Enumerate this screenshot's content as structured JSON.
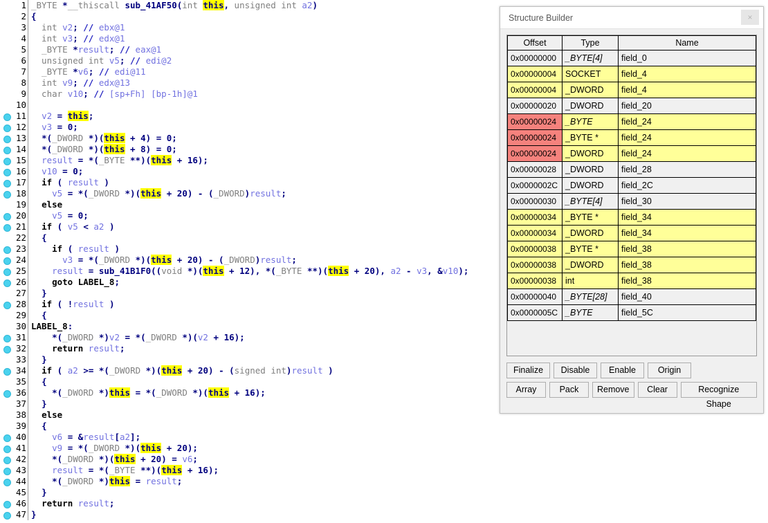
{
  "code_pane": {
    "name": "hexrays-decompiler-pseudocode",
    "lines": [
      {
        "n": "1",
        "bp": false,
        "t": "<span class='k'>_BYTE </span><span class='op'>*</span><span class='k'>__thiscall </span><span class='fn'>sub_41AF50</span><span class='op'>(</span><span class='k'>int </span><span class='hl'>this</span><span class='op'>,</span><span class='k'> unsigned int </span><span class='var'>a2</span><span class='op'>)</span>"
      },
      {
        "n": "2",
        "bp": false,
        "t": "<span class='op'>{</span>"
      },
      {
        "n": "3",
        "bp": false,
        "t": "<span class='k'>  int </span><span class='var'>v2</span><span class='op'>;</span> <span class='cm'>// </span><span class='cmt'>ebx@1</span>"
      },
      {
        "n": "4",
        "bp": false,
        "t": "<span class='k'>  int </span><span class='var'>v3</span><span class='op'>;</span> <span class='cm'>// </span><span class='cmt'>edx@1</span>"
      },
      {
        "n": "5",
        "bp": false,
        "t": "<span class='k'>  _BYTE </span><span class='op'>*</span><span class='var'>result</span><span class='op'>;</span> <span class='cm'>// </span><span class='cmt'>eax@1</span>"
      },
      {
        "n": "6",
        "bp": false,
        "t": "<span class='k'>  unsigned int </span><span class='var'>v5</span><span class='op'>;</span> <span class='cm'>// </span><span class='cmt'>edi@2</span>"
      },
      {
        "n": "7",
        "bp": false,
        "t": "<span class='k'>  _BYTE </span><span class='op'>*</span><span class='var'>v6</span><span class='op'>;</span> <span class='cm'>// </span><span class='cmt'>edi@11</span>"
      },
      {
        "n": "8",
        "bp": false,
        "t": "<span class='k'>  int </span><span class='var'>v9</span><span class='op'>;</span> <span class='cm'>// </span><span class='cmt'>edx@13</span>"
      },
      {
        "n": "9",
        "bp": false,
        "t": "<span class='k'>  char </span><span class='var'>v10</span><span class='op'>;</span> <span class='cm'>// </span><span class='cmt'>[sp+Fh] [bp-1h]@1</span>"
      },
      {
        "n": "10",
        "bp": false,
        "t": ""
      },
      {
        "n": "11",
        "bp": true,
        "t": "  <span class='var'>v2</span> <span class='op'>=</span> <span class='hl'>this</span><span class='op'>;</span>"
      },
      {
        "n": "12",
        "bp": true,
        "t": "  <span class='var'>v3</span> <span class='op'>=</span> <span class='num'>0</span><span class='op'>;</span>"
      },
      {
        "n": "13",
        "bp": true,
        "t": "  <span class='op'>*(</span><span class='k'>_DWORD </span><span class='op'>*)(</span><span class='hl'>this</span> <span class='op'>+</span> <span class='num'>4</span><span class='op'>)</span> <span class='op'>=</span> <span class='num'>0</span><span class='op'>;</span>"
      },
      {
        "n": "14",
        "bp": true,
        "t": "  <span class='op'>*(</span><span class='k'>_DWORD </span><span class='op'>*)(</span><span class='hl'>this</span> <span class='op'>+</span> <span class='num'>8</span><span class='op'>)</span> <span class='op'>=</span> <span class='num'>0</span><span class='op'>;</span>"
      },
      {
        "n": "15",
        "bp": true,
        "t": "  <span class='var'>result</span> <span class='op'>=</span> <span class='op'>*(</span><span class='k'>_BYTE </span><span class='op'>**)(</span><span class='hl'>this</span> <span class='op'>+</span> <span class='num'>16</span><span class='op'>);</span>"
      },
      {
        "n": "16",
        "bp": true,
        "t": "  <span class='var'>v10</span> <span class='op'>=</span> <span class='num'>0</span><span class='op'>;</span>"
      },
      {
        "n": "17",
        "bp": true,
        "t": "  <span class='pl'>if</span> <span class='op'>(</span> <span class='var'>result</span> <span class='op'>)</span>"
      },
      {
        "n": "18",
        "bp": true,
        "t": "    <span class='var'>v5</span> <span class='op'>=</span> <span class='op'>*(</span><span class='k'>_DWORD </span><span class='op'>*)(</span><span class='hl'>this</span> <span class='op'>+</span> <span class='num'>20</span><span class='op'>)</span> <span class='op'>-</span> <span class='op'>(</span><span class='k'>_DWORD</span><span class='op'>)</span><span class='var'>result</span><span class='op'>;</span>"
      },
      {
        "n": "19",
        "bp": false,
        "t": "  <span class='pl'>else</span>"
      },
      {
        "n": "20",
        "bp": true,
        "t": "    <span class='var'>v5</span> <span class='op'>=</span> <span class='num'>0</span><span class='op'>;</span>"
      },
      {
        "n": "21",
        "bp": true,
        "t": "  <span class='pl'>if</span> <span class='op'>(</span> <span class='var'>v5</span> <span class='op'>&lt;</span> <span class='var'>a2</span> <span class='op'>)</span>"
      },
      {
        "n": "22",
        "bp": false,
        "t": "  <span class='op'>{</span>"
      },
      {
        "n": "23",
        "bp": true,
        "t": "    <span class='pl'>if</span> <span class='op'>(</span> <span class='var'>result</span> <span class='op'>)</span>"
      },
      {
        "n": "24",
        "bp": true,
        "t": "      <span class='var'>v3</span> <span class='op'>=</span> <span class='op'>*(</span><span class='k'>_DWORD </span><span class='op'>*)(</span><span class='hl'>this</span> <span class='op'>+</span> <span class='num'>20</span><span class='op'>)</span> <span class='op'>-</span> <span class='op'>(</span><span class='k'>_DWORD</span><span class='op'>)</span><span class='var'>result</span><span class='op'>;</span>"
      },
      {
        "n": "25",
        "bp": true,
        "t": "    <span class='var'>result</span> <span class='op'>=</span> <span class='fn'>sub_41B1F0</span><span class='op'>((</span><span class='k'>void </span><span class='op'>*)(</span><span class='hl'>this</span> <span class='op'>+</span> <span class='num'>12</span><span class='op'>),</span> <span class='op'>*(</span><span class='k'>_BYTE </span><span class='op'>**)(</span><span class='hl'>this</span> <span class='op'>+</span> <span class='num'>20</span><span class='op'>),</span> <span class='var'>a2</span> <span class='op'>-</span> <span class='var'>v3</span><span class='op'>,</span> <span class='op'>&amp;</span><span class='var'>v10</span><span class='op'>);</span>"
      },
      {
        "n": "26",
        "bp": true,
        "t": "    <span class='pl'>goto</span> <span class='lbl'>LABEL_8</span><span class='op'>;</span>"
      },
      {
        "n": "27",
        "bp": false,
        "t": "  <span class='op'>}</span>"
      },
      {
        "n": "28",
        "bp": true,
        "t": "  <span class='pl'>if</span> <span class='op'>(</span> <span class='op'>!</span><span class='var'>result</span> <span class='op'>)</span>"
      },
      {
        "n": "29",
        "bp": false,
        "t": "  <span class='op'>{</span>"
      },
      {
        "n": "30",
        "bp": false,
        "t": "<span class='lbl'>LABEL_8</span><span class='op'>:</span>"
      },
      {
        "n": "31",
        "bp": true,
        "t": "    <span class='op'>*(</span><span class='k'>_DWORD </span><span class='op'>*)</span><span class='var'>v2</span> <span class='op'>=</span> <span class='op'>*(</span><span class='k'>_DWORD </span><span class='op'>*)(</span><span class='var'>v2</span> <span class='op'>+</span> <span class='num'>16</span><span class='op'>);</span>"
      },
      {
        "n": "32",
        "bp": true,
        "t": "    <span class='pl'>return</span> <span class='var'>result</span><span class='op'>;</span>"
      },
      {
        "n": "33",
        "bp": false,
        "t": "  <span class='op'>}</span>"
      },
      {
        "n": "34",
        "bp": true,
        "t": "  <span class='pl'>if</span> <span class='op'>(</span> <span class='var'>a2</span> <span class='op'>&gt;=</span> <span class='op'>*(</span><span class='k'>_DWORD </span><span class='op'>*)(</span><span class='hl'>this</span> <span class='op'>+</span> <span class='num'>20</span><span class='op'>)</span> <span class='op'>-</span> <span class='op'>(</span><span class='k'>signed int</span><span class='op'>)</span><span class='var'>result</span> <span class='op'>)</span>"
      },
      {
        "n": "35",
        "bp": false,
        "t": "  <span class='op'>{</span>"
      },
      {
        "n": "36",
        "bp": true,
        "t": "    <span class='op'>*(</span><span class='k'>_DWORD </span><span class='op'>*)</span><span class='hl'>this</span> <span class='op'>=</span> <span class='op'>*(</span><span class='k'>_DWORD </span><span class='op'>*)(</span><span class='hl'>this</span> <span class='op'>+</span> <span class='num'>16</span><span class='op'>);</span>"
      },
      {
        "n": "37",
        "bp": false,
        "t": "  <span class='op'>}</span>"
      },
      {
        "n": "38",
        "bp": false,
        "t": "  <span class='pl'>else</span>"
      },
      {
        "n": "39",
        "bp": false,
        "t": "  <span class='op'>{</span>"
      },
      {
        "n": "40",
        "bp": true,
        "t": "    <span class='var'>v6</span> <span class='op'>=</span> <span class='op'>&amp;</span><span class='var'>result</span><span class='op'>[</span><span class='var'>a2</span><span class='op'>];</span>"
      },
      {
        "n": "41",
        "bp": true,
        "t": "    <span class='var'>v9</span> <span class='op'>=</span> <span class='op'>*(</span><span class='k'>_DWORD </span><span class='op'>*)(</span><span class='hl'>this</span> <span class='op'>+</span> <span class='num'>20</span><span class='op'>);</span>"
      },
      {
        "n": "42",
        "bp": true,
        "t": "    <span class='op'>*(</span><span class='k'>_DWORD </span><span class='op'>*)(</span><span class='hl'>this</span> <span class='op'>+</span> <span class='num'>20</span><span class='op'>)</span> <span class='op'>=</span> <span class='var'>v6</span><span class='op'>;</span>"
      },
      {
        "n": "43",
        "bp": true,
        "t": "    <span class='var'>result</span> <span class='op'>=</span> <span class='op'>*(</span><span class='k'>_BYTE </span><span class='op'>**)(</span><span class='hl'>this</span> <span class='op'>+</span> <span class='num'>16</span><span class='op'>);</span>"
      },
      {
        "n": "44",
        "bp": true,
        "t": "    <span class='op'>*(</span><span class='k'>_DWORD </span><span class='op'>*)</span><span class='hl'>this</span> <span class='op'>=</span> <span class='var'>result</span><span class='op'>;</span>"
      },
      {
        "n": "45",
        "bp": false,
        "t": "  <span class='op'>}</span>"
      },
      {
        "n": "46",
        "bp": true,
        "t": "  <span class='pl'>return</span> <span class='var'>result</span><span class='op'>;</span>"
      },
      {
        "n": "47",
        "bp": true,
        "t": "<span class='op'>}</span>"
      }
    ]
  },
  "structure_builder": {
    "title": "Structure Builder",
    "close_label": "×",
    "columns": [
      "Offset",
      "Type",
      "Name"
    ],
    "rows": [
      {
        "offset": "0x00000000",
        "type": "_BYTE[4]",
        "name": "field_0",
        "row_color": "normal",
        "offset_color": "normal",
        "type_italic": true
      },
      {
        "offset": "0x00000004",
        "type": "SOCKET",
        "name": "field_4",
        "row_color": "yellow",
        "offset_color": "normal",
        "type_italic": false
      },
      {
        "offset": "0x00000004",
        "type": "_DWORD",
        "name": "field_4",
        "row_color": "yellow",
        "offset_color": "normal",
        "type_italic": false
      },
      {
        "offset": "0x00000020",
        "type": "_DWORD",
        "name": "field_20",
        "row_color": "normal",
        "offset_color": "normal",
        "type_italic": false
      },
      {
        "offset": "0x00000024",
        "type": "_BYTE",
        "name": "field_24",
        "row_color": "yellow",
        "offset_color": "red",
        "type_italic": true
      },
      {
        "offset": "0x00000024",
        "type": "_BYTE *",
        "name": "field_24",
        "row_color": "yellow",
        "offset_color": "red",
        "type_italic": false
      },
      {
        "offset": "0x00000024",
        "type": "_DWORD",
        "name": "field_24",
        "row_color": "yellow",
        "offset_color": "red",
        "type_italic": false
      },
      {
        "offset": "0x00000028",
        "type": "_DWORD",
        "name": "field_28",
        "row_color": "normal",
        "offset_color": "normal",
        "type_italic": false
      },
      {
        "offset": "0x0000002C",
        "type": "_DWORD",
        "name": "field_2C",
        "row_color": "normal",
        "offset_color": "normal",
        "type_italic": false
      },
      {
        "offset": "0x00000030",
        "type": "_BYTE[4]",
        "name": "field_30",
        "row_color": "normal",
        "offset_color": "normal",
        "type_italic": true
      },
      {
        "offset": "0x00000034",
        "type": "_BYTE *",
        "name": "field_34",
        "row_color": "yellow",
        "offset_color": "normal",
        "type_italic": false
      },
      {
        "offset": "0x00000034",
        "type": "_DWORD",
        "name": "field_34",
        "row_color": "yellow",
        "offset_color": "normal",
        "type_italic": false
      },
      {
        "offset": "0x00000038",
        "type": "_BYTE *",
        "name": "field_38",
        "row_color": "yellow",
        "offset_color": "normal",
        "type_italic": false
      },
      {
        "offset": "0x00000038",
        "type": "_DWORD",
        "name": "field_38",
        "row_color": "yellow",
        "offset_color": "normal",
        "type_italic": false
      },
      {
        "offset": "0x00000038",
        "type": "int",
        "name": "field_38",
        "row_color": "yellow",
        "offset_color": "normal",
        "type_italic": false
      },
      {
        "offset": "0x00000040",
        "type": "_BYTE[28]",
        "name": "field_40",
        "row_color": "normal",
        "offset_color": "normal",
        "type_italic": true
      },
      {
        "offset": "0x0000005C",
        "type": "_BYTE",
        "name": "field_5C",
        "row_color": "normal",
        "offset_color": "normal",
        "type_italic": true
      }
    ],
    "buttons_row1": [
      "Finalize",
      "Disable",
      "Enable",
      "Origin"
    ],
    "buttons_row2": [
      "Array",
      "Pack",
      "Remove",
      "Clear",
      "Recognize Shape"
    ]
  },
  "colors": {
    "highlight": "#ffff00",
    "row_yellow": "#ffff99",
    "offset_red": "#f5827d",
    "breakpoint_dot": "#4ad2ee",
    "keyword_gray": "#808080",
    "variable": "#7272e0",
    "function_navy": "#00007f"
  }
}
